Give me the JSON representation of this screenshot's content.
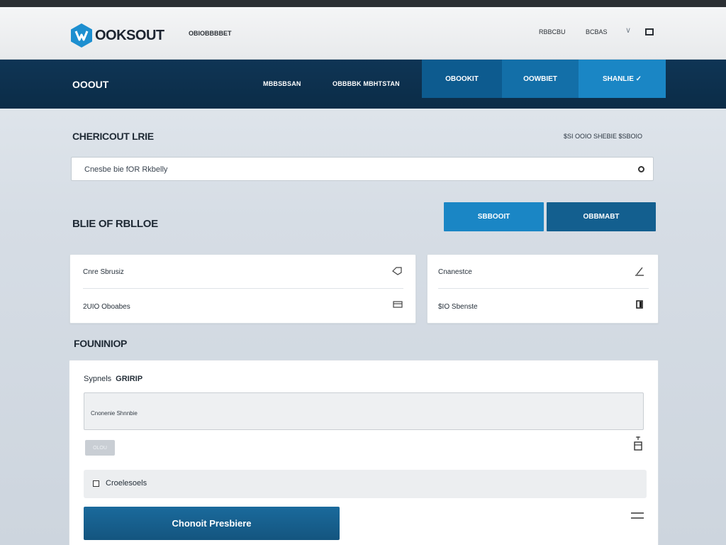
{
  "header": {
    "logo_text": "OOKSOUT",
    "tagline": "OBIOBBBBET",
    "links": [
      "RBBCBU",
      "BCBAS"
    ],
    "icons": {
      "chevron": "chevron-down-icon",
      "window": "window-icon",
      "logo": "hexagon-shield-logo"
    }
  },
  "nav": {
    "brand": "OOOUT",
    "links": [
      "MBBSBSAN",
      "OBBBBK MBHTSTAN"
    ],
    "tabs": [
      {
        "label": "OBOOKIT",
        "color": "#0d5b8f"
      },
      {
        "label": "OOWBIET",
        "color": "#136fa8"
      },
      {
        "label": "SHANLIE ✓",
        "color": "#1a86c5"
      }
    ]
  },
  "page": {
    "title": "CHERICOUT LRIE",
    "meta": "$SI OOIO SHEBIE $SBOIO"
  },
  "search": {
    "placeholder": "Cnesbe bie fOR Rkbelly",
    "icon": "search-icon"
  },
  "section2": {
    "title": "BLIE OF RBLLOE",
    "buttons": [
      {
        "label": "SBBOOIT",
        "color": "#1a86c5"
      },
      {
        "label": "OBBMABT",
        "color": "#135f8f"
      }
    ]
  },
  "cards": {
    "left": {
      "rows": [
        {
          "label": "Cnre Sbrusiz",
          "icon": "tag-icon"
        },
        {
          "label": "2UIO Oboabes",
          "icon": "card-icon"
        }
      ]
    },
    "right": {
      "rows": [
        {
          "label": "Cnanestce",
          "icon": "pen-icon"
        },
        {
          "label": "$IO Sbenste",
          "icon": "door-icon"
        }
      ]
    }
  },
  "form": {
    "section_title": "FOUNINIOP",
    "label_light": "Sypnels",
    "label_bold": "GRIRIP",
    "input_text": "Cnonenie Shnnbie",
    "small_tag": "OLOU",
    "trash_icon": "trash-icon",
    "checkbox_label": "Croelesoels",
    "primary_button": "Chonoit Presbiere",
    "menu_icon": "menu-icon"
  },
  "colors": {
    "nav_bg": "#0b2c47",
    "accent": "#1a86c5",
    "primary": "#14557f"
  }
}
